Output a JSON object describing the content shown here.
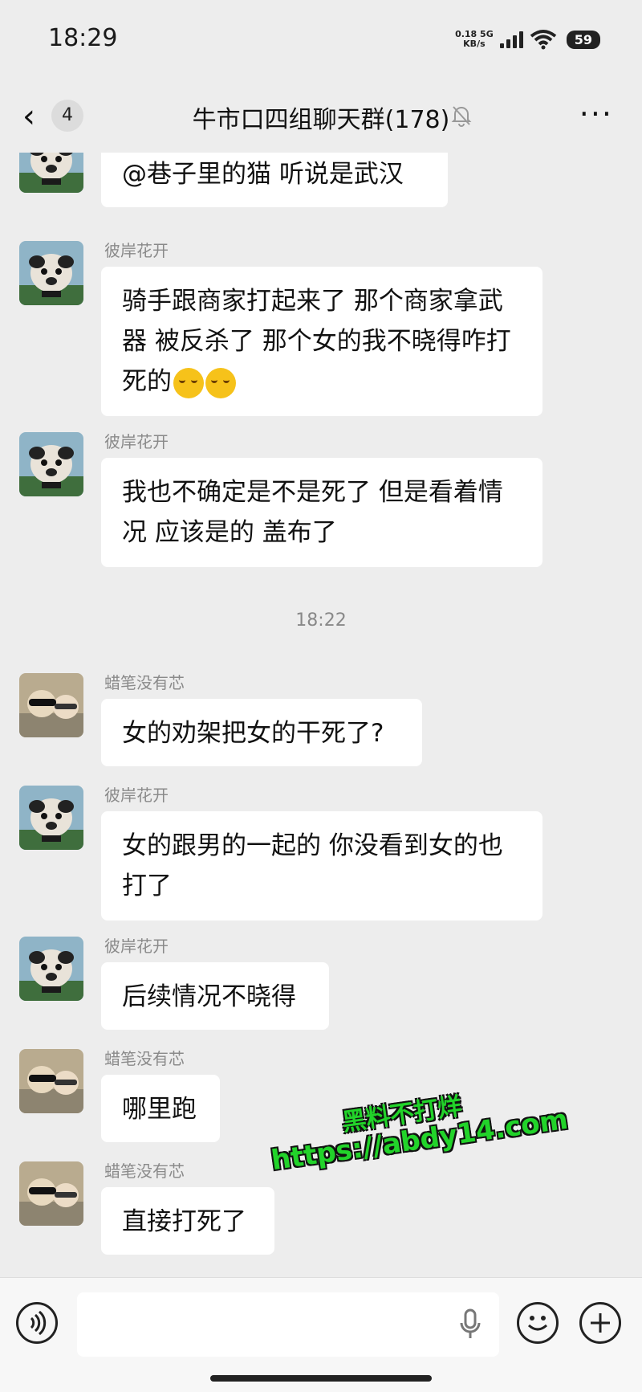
{
  "status": {
    "time": "18:29",
    "net_speed": "0.18",
    "net_unit": "KB/s",
    "net_type": "5G",
    "battery": "59"
  },
  "header": {
    "back_count": "4",
    "title": "牛市口四组聊天群(178)"
  },
  "messages": [
    {
      "sender": "",
      "text": "@巷子里的猫  听说是武汉",
      "avatar": "dog-avatar"
    },
    {
      "sender": "彼岸花开",
      "text": "骑手跟商家打起来了  那个商家拿武器  被反杀了    那个女的我不晓得咋打死的",
      "emoji": "😭😭",
      "avatar": "dog-avatar"
    },
    {
      "sender": "彼岸花开",
      "text": "我也不确定是不是死了   但是看着情况      应该是的  盖布了",
      "avatar": "dog-avatar"
    },
    {
      "sender": "蜡笔没有芯",
      "text": "女的劝架把女的干死了?",
      "avatar": "cat-avatar"
    },
    {
      "sender": "彼岸花开",
      "text": "女的跟男的一起的  你没看到女的也打了",
      "avatar": "dog-avatar"
    },
    {
      "sender": "彼岸花开",
      "text": "后续情况不晓得",
      "avatar": "dog-avatar"
    },
    {
      "sender": "蜡笔没有芯",
      "text": "哪里跑",
      "avatar": "cat-avatar"
    },
    {
      "sender": "蜡笔没有芯",
      "text": "直接打死了",
      "avatar": "cat-avatar"
    }
  ],
  "timestamp": "18:22",
  "watermark": {
    "line1": "黑料不打烊",
    "line2": "https://abdy14.com"
  },
  "icons": {
    "back": "chevron-left-icon",
    "mute": "mute-bell-icon",
    "more": "more-icon",
    "voice": "voice-icon",
    "mic": "mic-icon",
    "emoji": "emoji-icon",
    "plus": "plus-icon"
  }
}
